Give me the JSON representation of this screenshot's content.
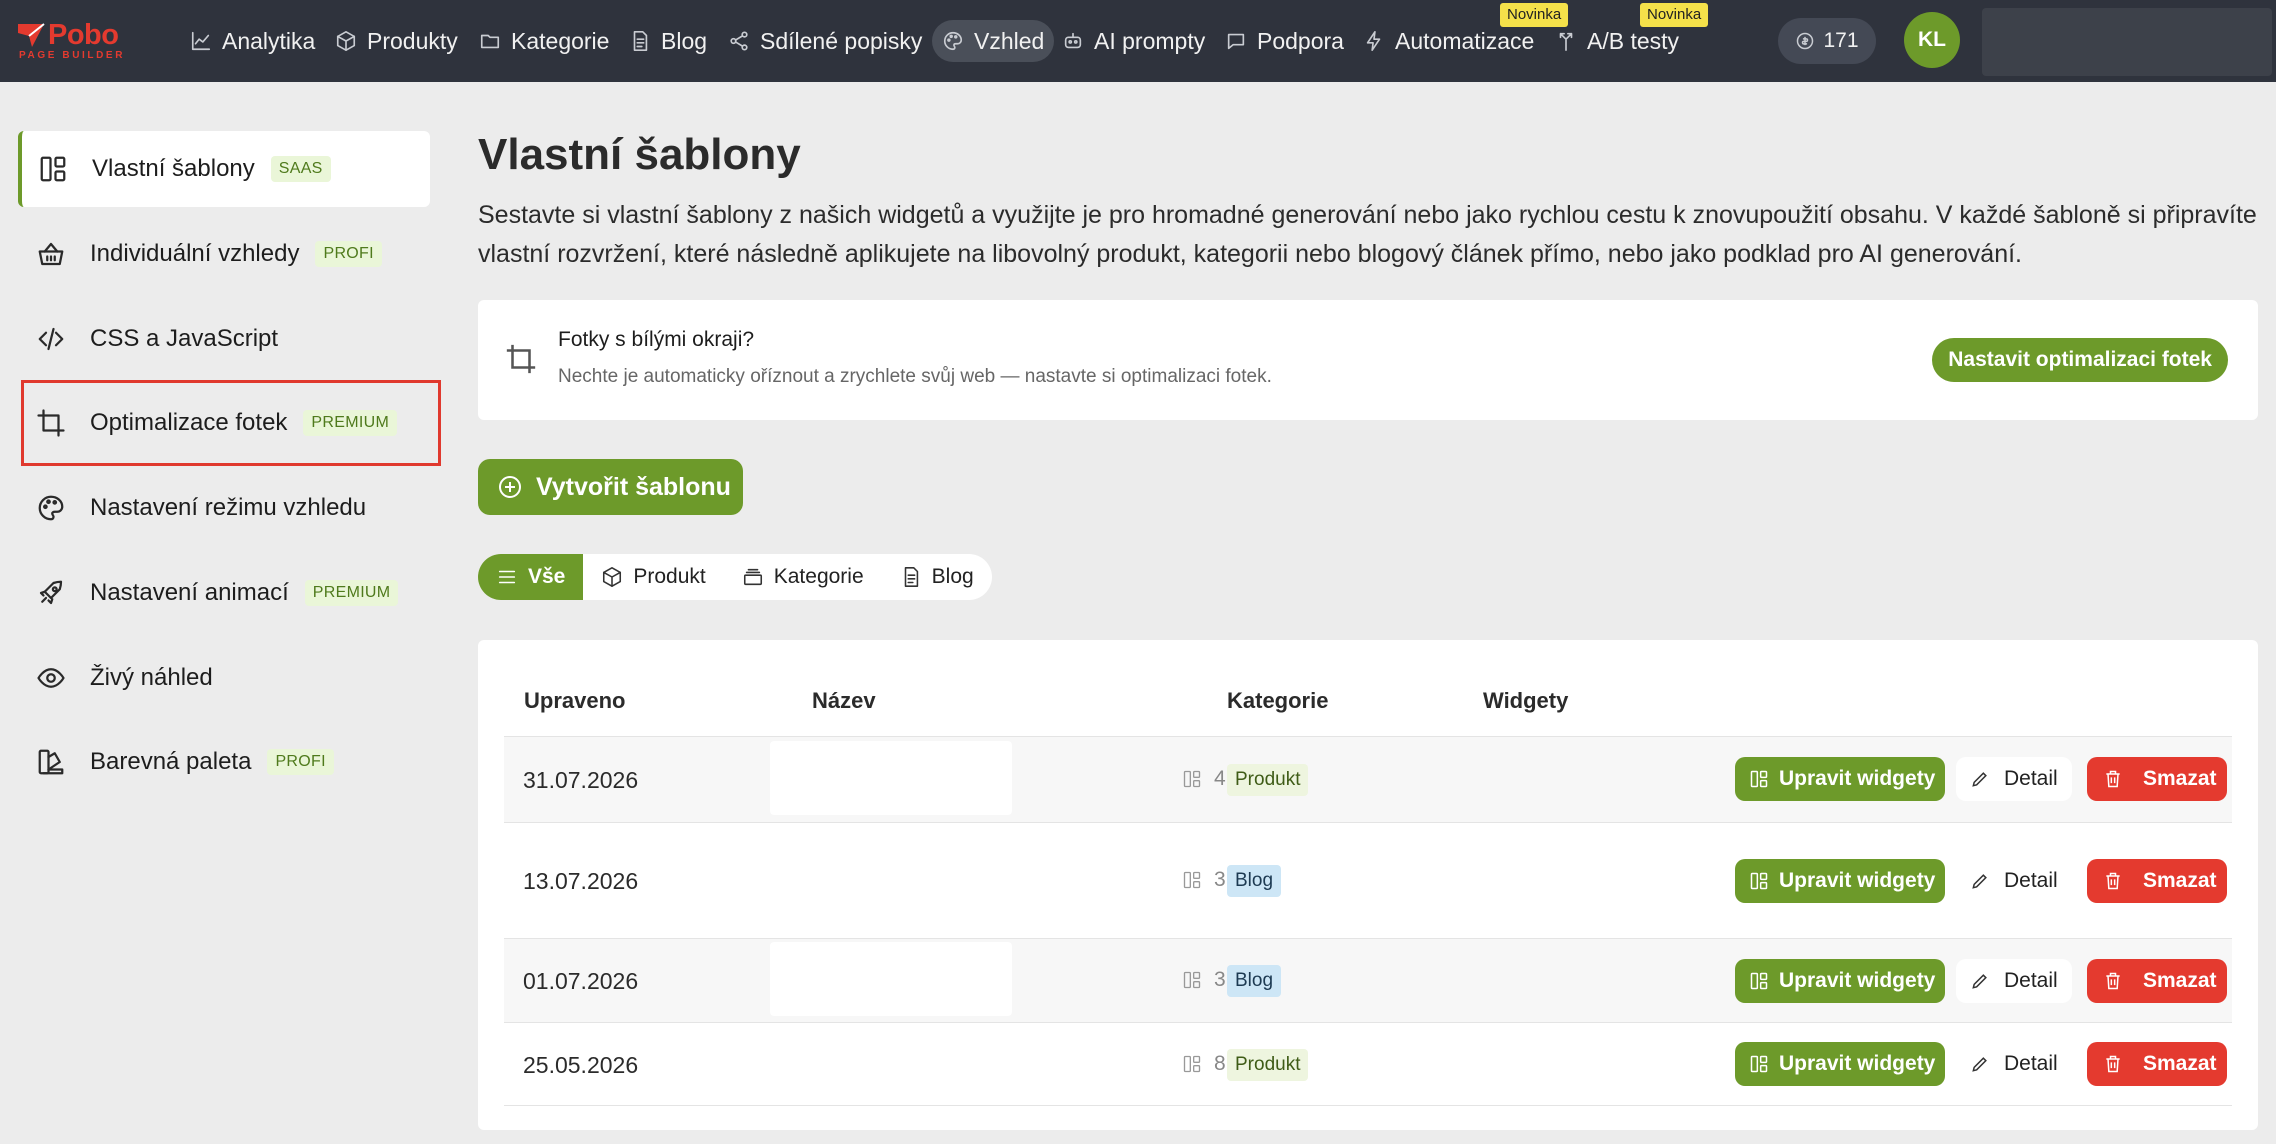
{
  "logo": {
    "name": "Pobo",
    "subtitle": "PAGE BUILDER"
  },
  "nav": [
    {
      "label": "Analytika",
      "icon": "chart-icon"
    },
    {
      "label": "Produkty",
      "icon": "box-icon"
    },
    {
      "label": "Kategorie",
      "icon": "folder-icon"
    },
    {
      "label": "Blog",
      "icon": "document-icon"
    },
    {
      "label": "Sdílené popisky",
      "icon": "share-icon"
    },
    {
      "label": "Vzhled",
      "icon": "palette-icon",
      "active": true
    },
    {
      "label": "AI prompty",
      "icon": "robot-icon"
    },
    {
      "label": "Podpora",
      "icon": "chat-icon"
    },
    {
      "label": "Automatizace",
      "icon": "bolt-icon",
      "badge": "Novinka"
    },
    {
      "label": "A/B testy",
      "icon": "split-icon",
      "badge": "Novinka"
    }
  ],
  "credits": "171",
  "user_initials": "KL",
  "sidebar": [
    {
      "label": "Vlastní šablony",
      "badge": "SAAS",
      "icon": "layout-icon",
      "active": true
    },
    {
      "label": "Individuální vzhledy",
      "badge": "PROFI",
      "icon": "basket-icon"
    },
    {
      "label": "CSS a JavaScript",
      "badge": "",
      "icon": "code-icon"
    },
    {
      "label": "Optimalizace fotek",
      "badge": "PREMIUM",
      "icon": "crop-icon"
    },
    {
      "label": "Nastavení režimu vzhledu",
      "badge": "",
      "icon": "palette-icon"
    },
    {
      "label": "Nastavení animací",
      "badge": "PREMIUM",
      "icon": "rocket-icon"
    },
    {
      "label": "Živý náhled",
      "badge": "",
      "icon": "eye-icon"
    },
    {
      "label": "Barevná paleta",
      "badge": "PROFI",
      "icon": "swatch-icon"
    }
  ],
  "main": {
    "title": "Vlastní šablony",
    "description": "Sestavte si vlastní šablony z našich widgetů a využijte je pro hromadné generování nebo jako rychlou cestu k znovupoužití obsahu. V každé šabloně si připravíte vlastní rozvržení, které následně aplikujete na libovolný produkt, kategorii nebo blogový článek přímo, nebo jako podklad pro AI generování.",
    "notice": {
      "title": "Fotky s bílými okraji?",
      "text": "Nechte je automaticky oříznout a zrychlete svůj web — nastavte si optimalizaci fotek.",
      "button": "Nastavit optimalizaci fotek"
    },
    "create_button": "Vytvořit šablonu",
    "filters": [
      {
        "label": "Vše",
        "icon": "list-icon",
        "active": true
      },
      {
        "label": "Produkt",
        "icon": "box-icon"
      },
      {
        "label": "Kategorie",
        "icon": "stack-icon"
      },
      {
        "label": "Blog",
        "icon": "document-icon"
      }
    ],
    "table": {
      "columns": [
        "Upraveno",
        "Název",
        "Kategorie",
        "Widgety"
      ],
      "rows": [
        {
          "date": "31.07.2026",
          "name": "",
          "category": "Produkt",
          "widgets": "4"
        },
        {
          "date": "13.07.2026",
          "name": "",
          "category": "Blog",
          "widgets": "3"
        },
        {
          "date": "01.07.2026",
          "name": "",
          "category": "Blog",
          "widgets": "3"
        },
        {
          "date": "25.05.2026",
          "name": "",
          "category": "Produkt",
          "widgets": "8"
        }
      ],
      "actions": {
        "edit": "Upravit widgety",
        "detail": "Detail",
        "delete": "Smazat"
      }
    }
  },
  "colors": {
    "brand_red": "#e43a2f",
    "accent_green": "#6d9a2a",
    "topbar": "#2f333d",
    "danger": "#e43a2f"
  }
}
